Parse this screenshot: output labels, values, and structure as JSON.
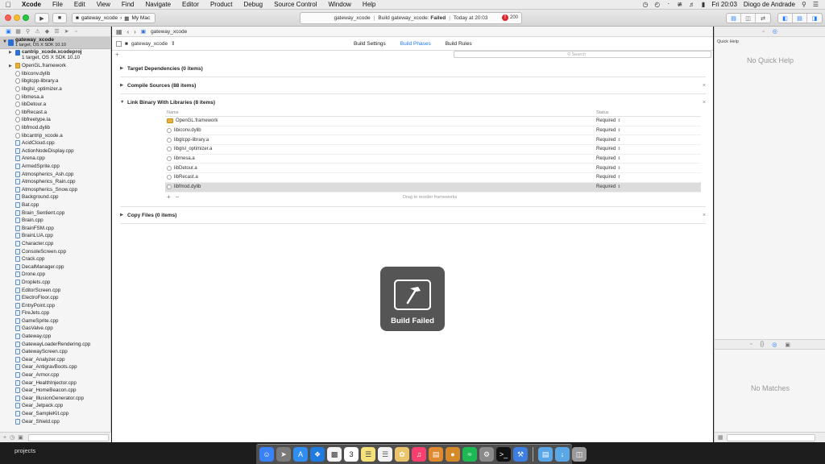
{
  "menubar": {
    "app": "Xcode",
    "items": [
      "File",
      "Edit",
      "View",
      "Find",
      "Navigate",
      "Editor",
      "Product",
      "Debug",
      "Source Control",
      "Window",
      "Help"
    ],
    "clock": "Fri 20:03",
    "user": "Diogo de Andrade"
  },
  "toolbar": {
    "scheme": "gateway_xcode",
    "destination": "My Mac",
    "activity_project": "gateway_xcode",
    "activity_build": "Build gateway_xcode:",
    "activity_status": "Failed",
    "activity_time": "Today at 20:03",
    "error_count": "200"
  },
  "navigator": {
    "project_name": "gateway_xcode",
    "project_sub": "1 target, OS X SDK 10.10",
    "subproject_name": "cantrip_xcode.xcodeproj",
    "subproject_sub": "1 target, OS X SDK 10.10",
    "files": [
      {
        "name": "OpenGL.framework",
        "kind": "fw"
      },
      {
        "name": "libiconv.dylib",
        "kind": "lib"
      },
      {
        "name": "libglcpp-library.a",
        "kind": "lib"
      },
      {
        "name": "libglsl_optimizer.a",
        "kind": "lib"
      },
      {
        "name": "libmesa.a",
        "kind": "lib"
      },
      {
        "name": "libDetour.a",
        "kind": "lib"
      },
      {
        "name": "libRecast.a",
        "kind": "lib"
      },
      {
        "name": "libfreetype.la",
        "kind": "lib"
      },
      {
        "name": "libfmod.dylib",
        "kind": "lib"
      },
      {
        "name": "libcantrip_xcode.a",
        "kind": "lib"
      },
      {
        "name": "AcidCloud.cpp",
        "kind": "cpp"
      },
      {
        "name": "ActionNodeDisplay.cpp",
        "kind": "cpp"
      },
      {
        "name": "Arena.cpp",
        "kind": "cpp"
      },
      {
        "name": "ArmedSprite.cpp",
        "kind": "cpp"
      },
      {
        "name": "Atmospherics_Ash.cpp",
        "kind": "cpp"
      },
      {
        "name": "Atmospherics_Rain.cpp",
        "kind": "cpp"
      },
      {
        "name": "Atmospherics_Snow.cpp",
        "kind": "cpp"
      },
      {
        "name": "Background.cpp",
        "kind": "cpp"
      },
      {
        "name": "Bat.cpp",
        "kind": "cpp"
      },
      {
        "name": "Brain_Sentient.cpp",
        "kind": "cpp"
      },
      {
        "name": "Brain.cpp",
        "kind": "cpp"
      },
      {
        "name": "BrainFSM.cpp",
        "kind": "cpp"
      },
      {
        "name": "BrainLUA.cpp",
        "kind": "cpp"
      },
      {
        "name": "Character.cpp",
        "kind": "cpp"
      },
      {
        "name": "ConsoleScreen.cpp",
        "kind": "cpp"
      },
      {
        "name": "Crack.cpp",
        "kind": "cpp"
      },
      {
        "name": "DecalManager.cpp",
        "kind": "cpp"
      },
      {
        "name": "Drone.cpp",
        "kind": "cpp"
      },
      {
        "name": "Droplets.cpp",
        "kind": "cpp"
      },
      {
        "name": "EditorScreen.cpp",
        "kind": "cpp"
      },
      {
        "name": "ElectroFloor.cpp",
        "kind": "cpp"
      },
      {
        "name": "EntryPoint.cpp",
        "kind": "cpp"
      },
      {
        "name": "FireJets.cpp",
        "kind": "cpp"
      },
      {
        "name": "GameSprite.cpp",
        "kind": "cpp"
      },
      {
        "name": "GasValve.cpp",
        "kind": "cpp"
      },
      {
        "name": "Gateway.cpp",
        "kind": "cpp"
      },
      {
        "name": "GatewayLoaderRendering.cpp",
        "kind": "cpp"
      },
      {
        "name": "GatewayScreen.cpp",
        "kind": "cpp"
      },
      {
        "name": "Gear_Analyzer.cpp",
        "kind": "cpp"
      },
      {
        "name": "Gear_AntigravBoots.cpp",
        "kind": "cpp"
      },
      {
        "name": "Gear_Armor.cpp",
        "kind": "cpp"
      },
      {
        "name": "Gear_HealthInjector.cpp",
        "kind": "cpp"
      },
      {
        "name": "Gear_HomeBeacon.cpp",
        "kind": "cpp"
      },
      {
        "name": "Gear_IllusionGenerator.cpp",
        "kind": "cpp"
      },
      {
        "name": "Gear_Jetpack.cpp",
        "kind": "cpp"
      },
      {
        "name": "Gear_SampleKit.cpp",
        "kind": "cpp"
      },
      {
        "name": "Gear_Shield.cpp",
        "kind": "cpp"
      }
    ]
  },
  "editor": {
    "breadcrumb": "gateway_xcode",
    "target": "gateway_xcode",
    "tabs": [
      "Build Settings",
      "Build Phases",
      "Build Rules"
    ],
    "search_placeholder": "Search",
    "phases": {
      "deps": "Target Dependencies (0 items)",
      "compile": "Compile Sources (88 items)",
      "link": "Link Binary With Libraries (8 items)",
      "copy": "Copy Files (0 items)"
    },
    "table_headers": {
      "name": "Name",
      "status": "Status"
    },
    "libraries": [
      {
        "name": "OpenGL.framework",
        "status": "Required",
        "kind": "fw"
      },
      {
        "name": "libiconv.dylib",
        "status": "Required",
        "kind": "lib"
      },
      {
        "name": "libglcpp-library.a",
        "status": "Required",
        "kind": "lib"
      },
      {
        "name": "libglsl_optimizer.a",
        "status": "Required",
        "kind": "lib"
      },
      {
        "name": "libmesa.a",
        "status": "Required",
        "kind": "lib"
      },
      {
        "name": "libDetour.a",
        "status": "Required",
        "kind": "lib"
      },
      {
        "name": "libRecast.a",
        "status": "Required",
        "kind": "lib"
      },
      {
        "name": "libfmod.dylib",
        "status": "Required",
        "kind": "lib"
      }
    ],
    "drag_hint": "Drag to reorder frameworks"
  },
  "hud": {
    "label": "Build Failed"
  },
  "utilities": {
    "quick_help_title": "Quick Help",
    "quick_help_empty": "No Quick Help",
    "library_empty": "No Matches"
  },
  "bottom": {
    "label": "projects"
  },
  "colors": {
    "accent": "#1b78ff",
    "error": "#e0242b"
  }
}
